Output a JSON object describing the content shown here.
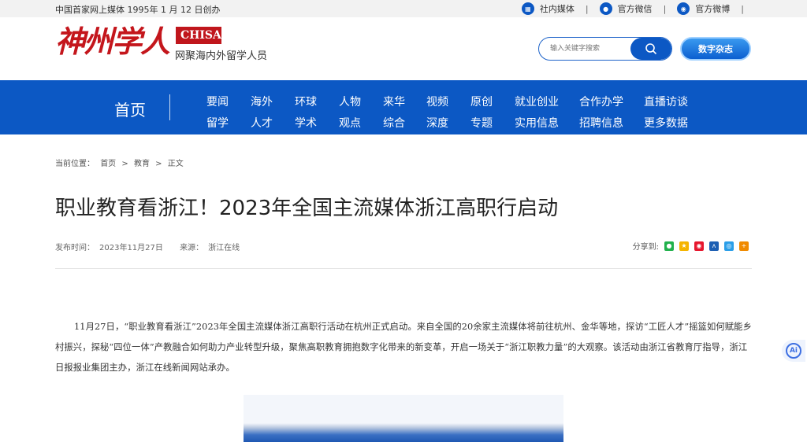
{
  "topbar": {
    "since": "中国首家网上媒体 1995年 1 月 12 日创办",
    "links": [
      {
        "label": "社内媒体",
        "icon": "grid-icon"
      },
      {
        "label": "官方微信",
        "icon": "wechat-icon"
      },
      {
        "label": "官方微博",
        "icon": "weibo-icon"
      }
    ],
    "separator": "|"
  },
  "header": {
    "logo_text": "神州学人",
    "badge": "CHISA",
    "slogan": "网聚海内外留学人员",
    "search_placeholder": "输入关键字搜索",
    "magazine_button": "数字杂志"
  },
  "nav": {
    "home": "首页",
    "columns": [
      [
        "要闻",
        "留学"
      ],
      [
        "海外",
        "人才"
      ],
      [
        "环球",
        "学术"
      ],
      [
        "人物",
        "观点"
      ],
      [
        "来华",
        "综合"
      ],
      [
        "视频",
        "深度"
      ],
      [
        "原创",
        "专题"
      ],
      [
        "就业创业",
        "实用信息"
      ],
      [
        "合作办学",
        "招聘信息"
      ],
      [
        "直播访谈",
        "更多数据"
      ]
    ]
  },
  "breadcrumb": {
    "prefix": "当前位置：",
    "items": [
      "首页",
      "教育",
      "正文"
    ],
    "separator": ">"
  },
  "article": {
    "title": "职业教育看浙江！2023年全国主流媒体浙江高职行启动",
    "date_label": "发布时间：",
    "date": "2023年11月27日",
    "source_label": "来源：",
    "source": "浙江在线",
    "share_label": "分享到:",
    "body": "11月27日，“职业教育看浙江”2023年全国主流媒体浙江高职行活动在杭州正式启动。来自全国的20余家主流媒体将前往杭州、金华等地，探访“工匠人才”摇篮如何赋能乡村振兴，探秘“四位一体”产教融合如何助力产业转型升级，聚焦高职教育拥抱数字化带来的新变革，开启一场关于“浙江职教力量”的大观察。该活动由浙江省教育厅指导，浙江日报报业集团主办，浙江在线新闻网站承办。"
  },
  "share_icons": [
    {
      "name": "wechat-share-icon",
      "color": "#22b14c"
    },
    {
      "name": "qzone-share-icon",
      "color": "#f5b400"
    },
    {
      "name": "weibo-share-icon",
      "color": "#e6162d"
    },
    {
      "name": "renren-share-icon",
      "color": "#1d5fb3"
    },
    {
      "name": "tencent-share-icon",
      "color": "#2a9ee8"
    },
    {
      "name": "more-share-icon",
      "color": "#f08a00"
    }
  ],
  "colors": {
    "brand_red": "#c4161c",
    "nav_blue": "#0c58c4"
  },
  "ai_button": "Ai"
}
